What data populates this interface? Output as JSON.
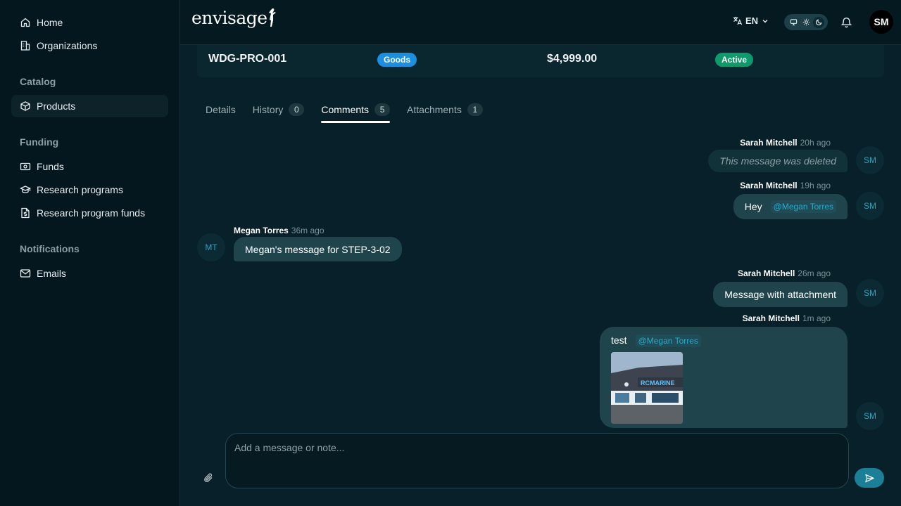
{
  "sidebar": {
    "home": "Home",
    "organizations": "Organizations",
    "catalog_section": "Catalog",
    "products": "Products",
    "funding_section": "Funding",
    "funds": "Funds",
    "research_programs": "Research programs",
    "research_program_funds": "Research program funds",
    "notifications_section": "Notifications",
    "emails": "Emails"
  },
  "topbar": {
    "logo": "envisage",
    "language": "EN",
    "user_initials": "SM"
  },
  "product": {
    "code": "WDG-PRO-001",
    "type": "Goods",
    "price": "$4,999.00",
    "status": "Active"
  },
  "tabs": [
    {
      "label": "Details",
      "count": ""
    },
    {
      "label": "History",
      "count": "0"
    },
    {
      "label": "Comments",
      "count": "5"
    },
    {
      "label": "Attachments",
      "count": "1"
    }
  ],
  "messages": [
    {
      "author": "Sarah Mitchell",
      "time": "20h ago",
      "text": "This message was deleted",
      "initials": "SM"
    },
    {
      "author": "Sarah Mitchell",
      "time": "19h ago",
      "text": "Hey",
      "mention": "@Megan Torres",
      "initials": "SM"
    },
    {
      "author": "Megan Torres",
      "time": "36m ago",
      "text": "Megan's message for STEP-3-02",
      "initials": "MT"
    },
    {
      "author": "Sarah Mitchell",
      "time": "26m ago",
      "text": "Message with attachment",
      "initials": "SM"
    },
    {
      "author": "Sarah Mitchell",
      "time": "1m ago",
      "text": "test",
      "mention": "@Megan Torres",
      "initials": "SM"
    }
  ],
  "attachment_image_sign": "RCMARINE",
  "composer": {
    "placeholder": "Add a message or note..."
  },
  "colors": {
    "background": "#072029",
    "sidebar": "#05171e",
    "bubble": "#1f444c",
    "goods_badge": "#1d8fe0",
    "active_badge": "#0f9a6c",
    "mention": "#2eaac7",
    "send_button": "#1a7f97"
  }
}
